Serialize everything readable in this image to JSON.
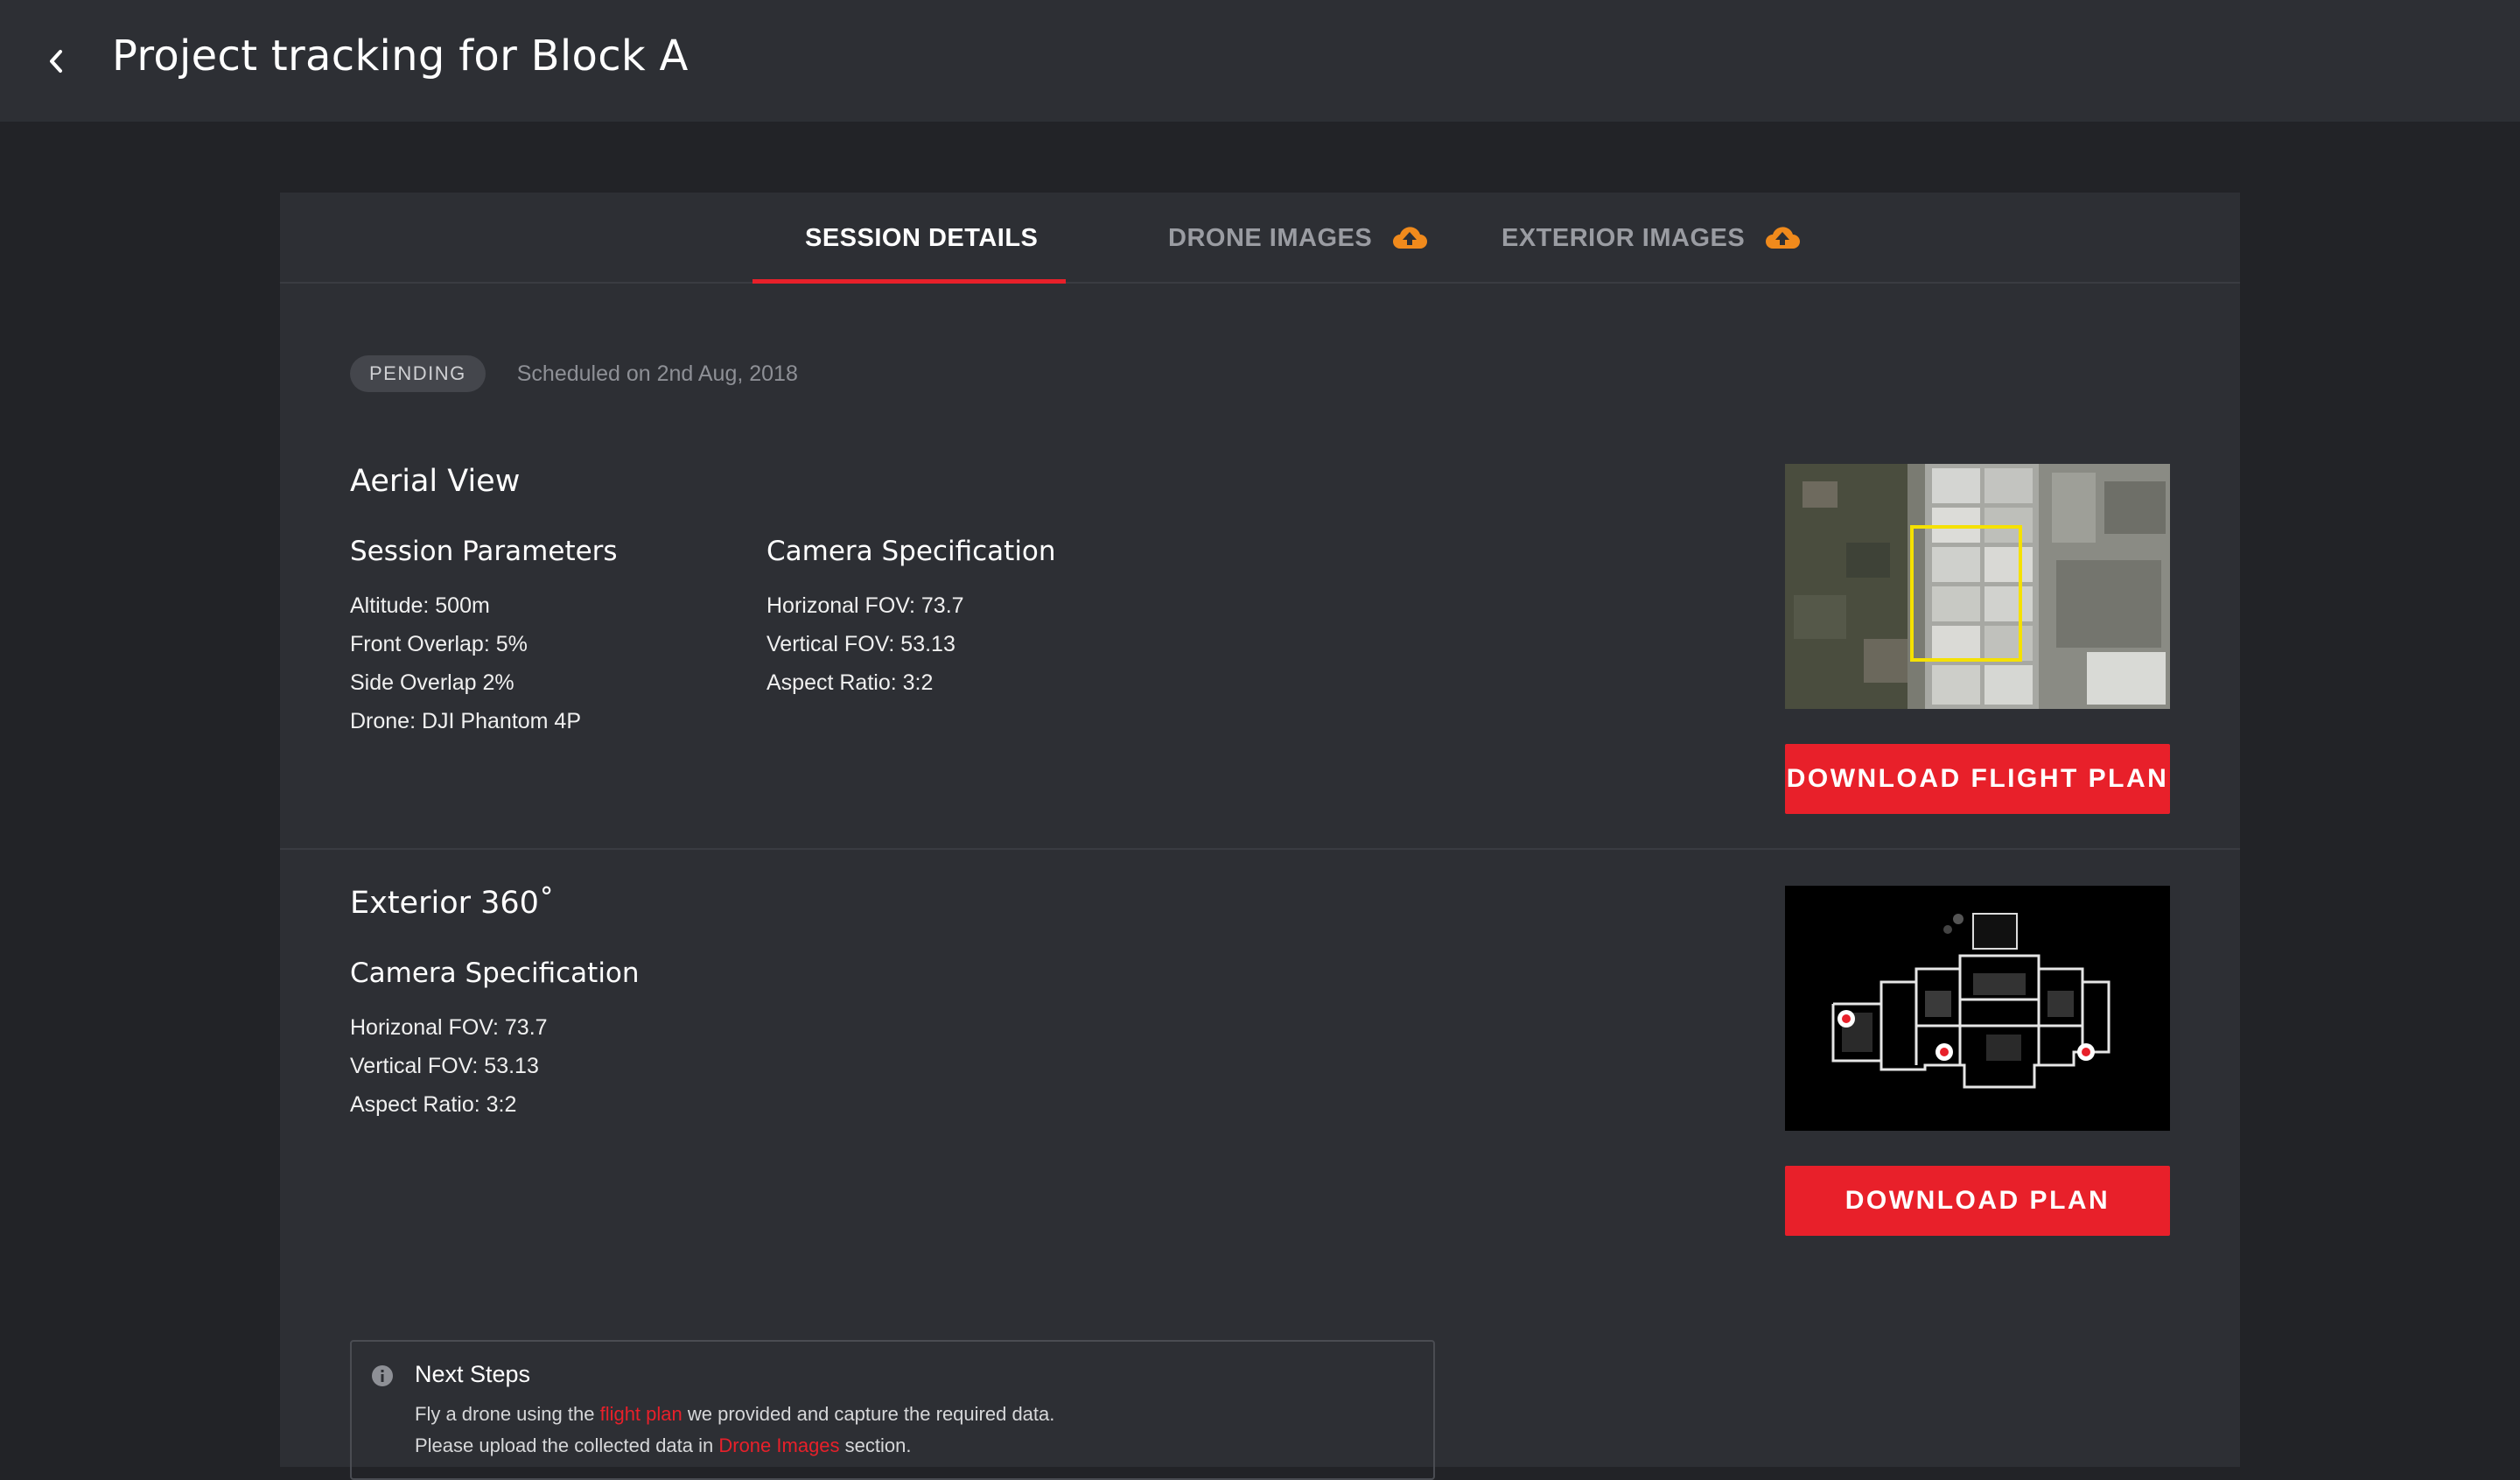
{
  "header": {
    "back_icon": "chevron-left-icon",
    "title": "Project tracking for Block A"
  },
  "tabs": [
    {
      "label": "SESSION DETAILS",
      "active": true
    },
    {
      "label": "DRONE IMAGES",
      "icon": "cloud-upload-icon",
      "active": false
    },
    {
      "label": "EXTERIOR IMAGES",
      "icon": "cloud-upload-icon",
      "active": false
    }
  ],
  "status": {
    "badge": "PENDING",
    "scheduled": "Scheduled on 2nd Aug, 2018"
  },
  "aerial": {
    "title": "Aerial View",
    "session_params": {
      "title": "Session Parameters",
      "items": [
        "Altitude: 500m",
        "Front Overlap: 5%",
        "Side Overlap 2%",
        "Drone: DJI Phantom 4P"
      ]
    },
    "camera_spec": {
      "title": "Camera Specification",
      "items": [
        "Horizonal FOV: 73.7",
        "Vertical FOV: 53.13",
        "Aspect Ratio: 3:2"
      ]
    },
    "button": "DOWNLOAD FLIGHT PLAN"
  },
  "exterior": {
    "title": "Exterior 360˚",
    "camera_spec": {
      "title": "Camera Specification",
      "items": [
        "Horizonal FOV: 73.7",
        "Vertical FOV: 53.13",
        "Aspect Ratio: 3:2"
      ]
    },
    "button": "DOWNLOAD PLAN"
  },
  "next_steps": {
    "title": "Next Steps",
    "line1_before": "Fly a drone using the ",
    "line1_link": "flight plan",
    "line1_after": " we provided and capture the required data.",
    "line2_before": "Please upload the collected data in ",
    "line2_link": "Drone Images",
    "line2_after": " section."
  },
  "colors": {
    "accent": "#e8202a",
    "upload_icon": "#f08a1c",
    "highlight_box": "#f5e100"
  }
}
